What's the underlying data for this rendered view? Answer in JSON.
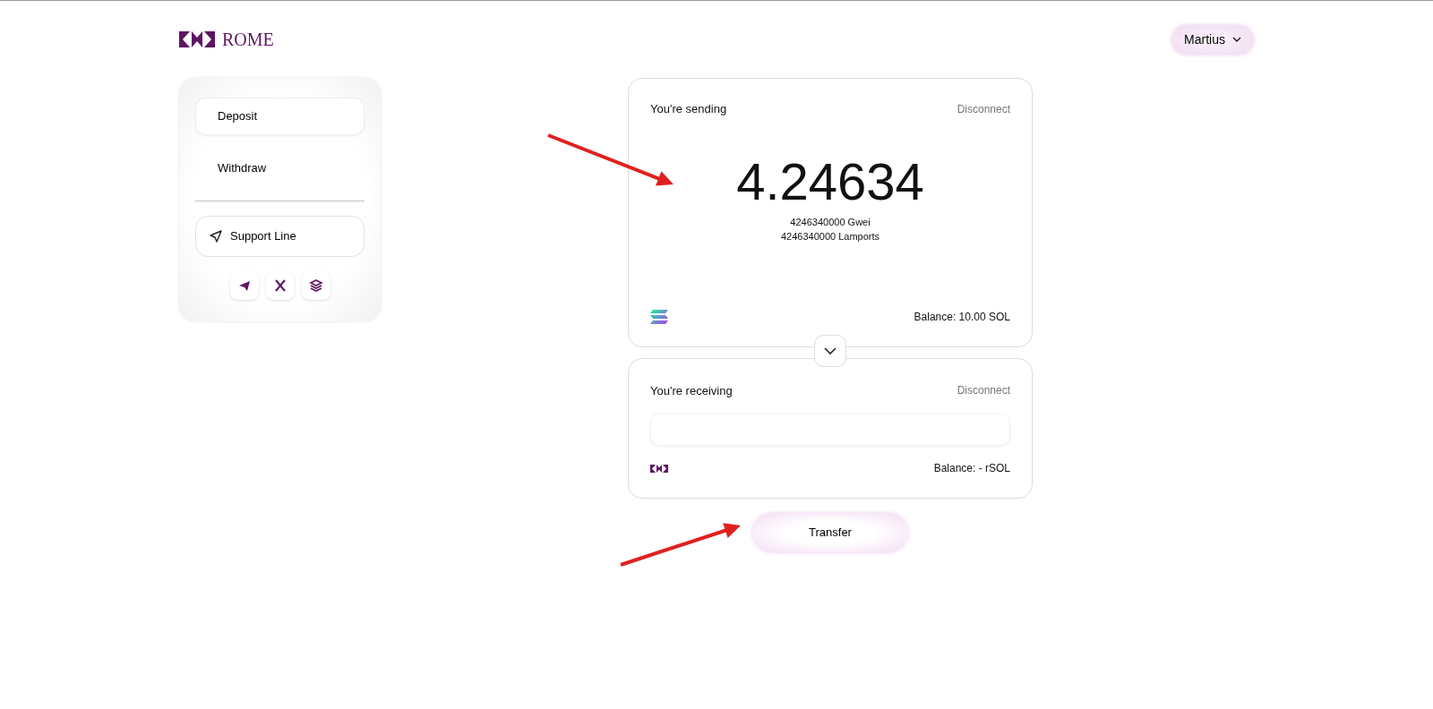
{
  "brand": {
    "name": "ROME"
  },
  "account": {
    "label": "Martius"
  },
  "sidebar": {
    "items": [
      {
        "label": "Deposit",
        "selected": true
      },
      {
        "label": "Withdraw",
        "selected": false
      }
    ],
    "support": {
      "label": "Support Line"
    },
    "socials": [
      {
        "kind": "telegram"
      },
      {
        "kind": "x"
      },
      {
        "kind": "layers"
      }
    ]
  },
  "sending": {
    "title": "You're sending",
    "action": "Disconnect",
    "amount": "4.24634",
    "sub_amounts": [
      "4246340000 Gwei",
      "4246340000 Lamports"
    ],
    "kind": "sol",
    "balance": "Balance: 10.00 SOL"
  },
  "receiving": {
    "title": "You're receiving",
    "action": "Disconnect",
    "kind": "rome",
    "balance": "Balance: - rSOL"
  },
  "transfer_button": {
    "label": "Transfer"
  }
}
